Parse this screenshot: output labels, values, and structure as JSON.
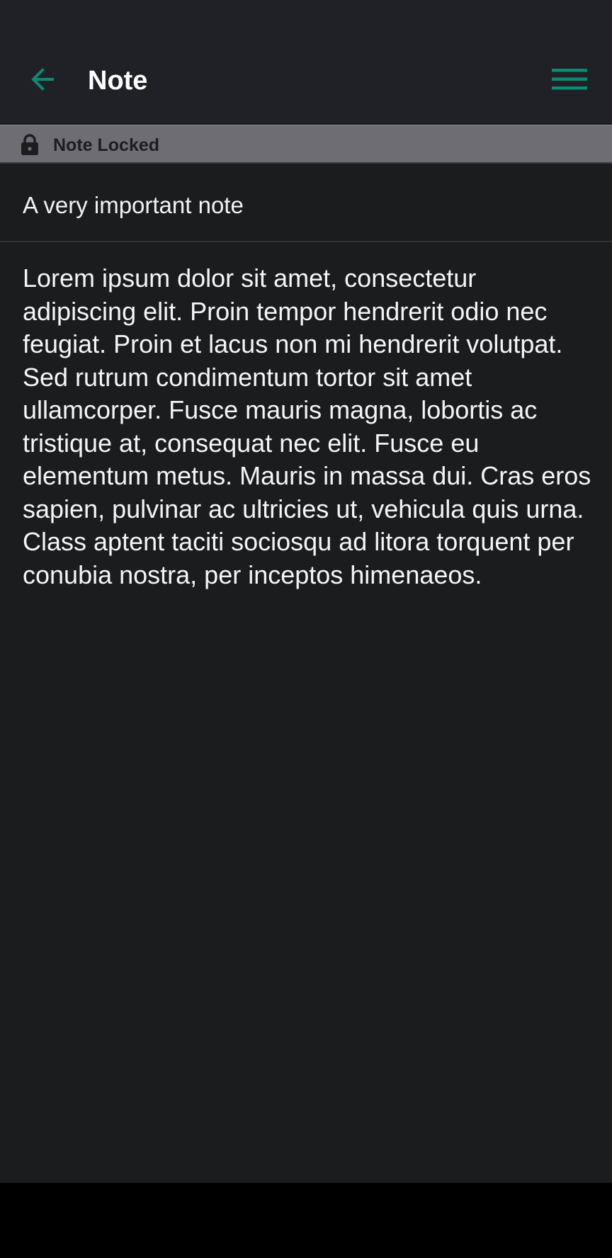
{
  "app_bar": {
    "title": "Note",
    "back_icon": "arrow-left-icon",
    "menu_icon": "hamburger-menu-icon",
    "accent_color": "#0e8a72"
  },
  "lock_banner": {
    "icon": "lock-icon",
    "label": "Note Locked"
  },
  "note": {
    "title": "A very important note",
    "body": "Lorem ipsum dolor sit amet, consectetur adipiscing elit. Proin tempor hendrerit odio nec feugiat. Proin et lacus non mi hendrerit volutpat. Sed rutrum condimentum tortor sit amet ullamcorper. Fusce mauris magna, lobortis ac tristique at, consequat nec elit. Fusce eu elementum metus. Mauris in massa dui. Cras eros sapien, pulvinar ac ultricies ut, vehicula quis urna. Class aptent taciti sociosqu ad litora torquent per conubia nostra, per inceptos himenaeos."
  }
}
